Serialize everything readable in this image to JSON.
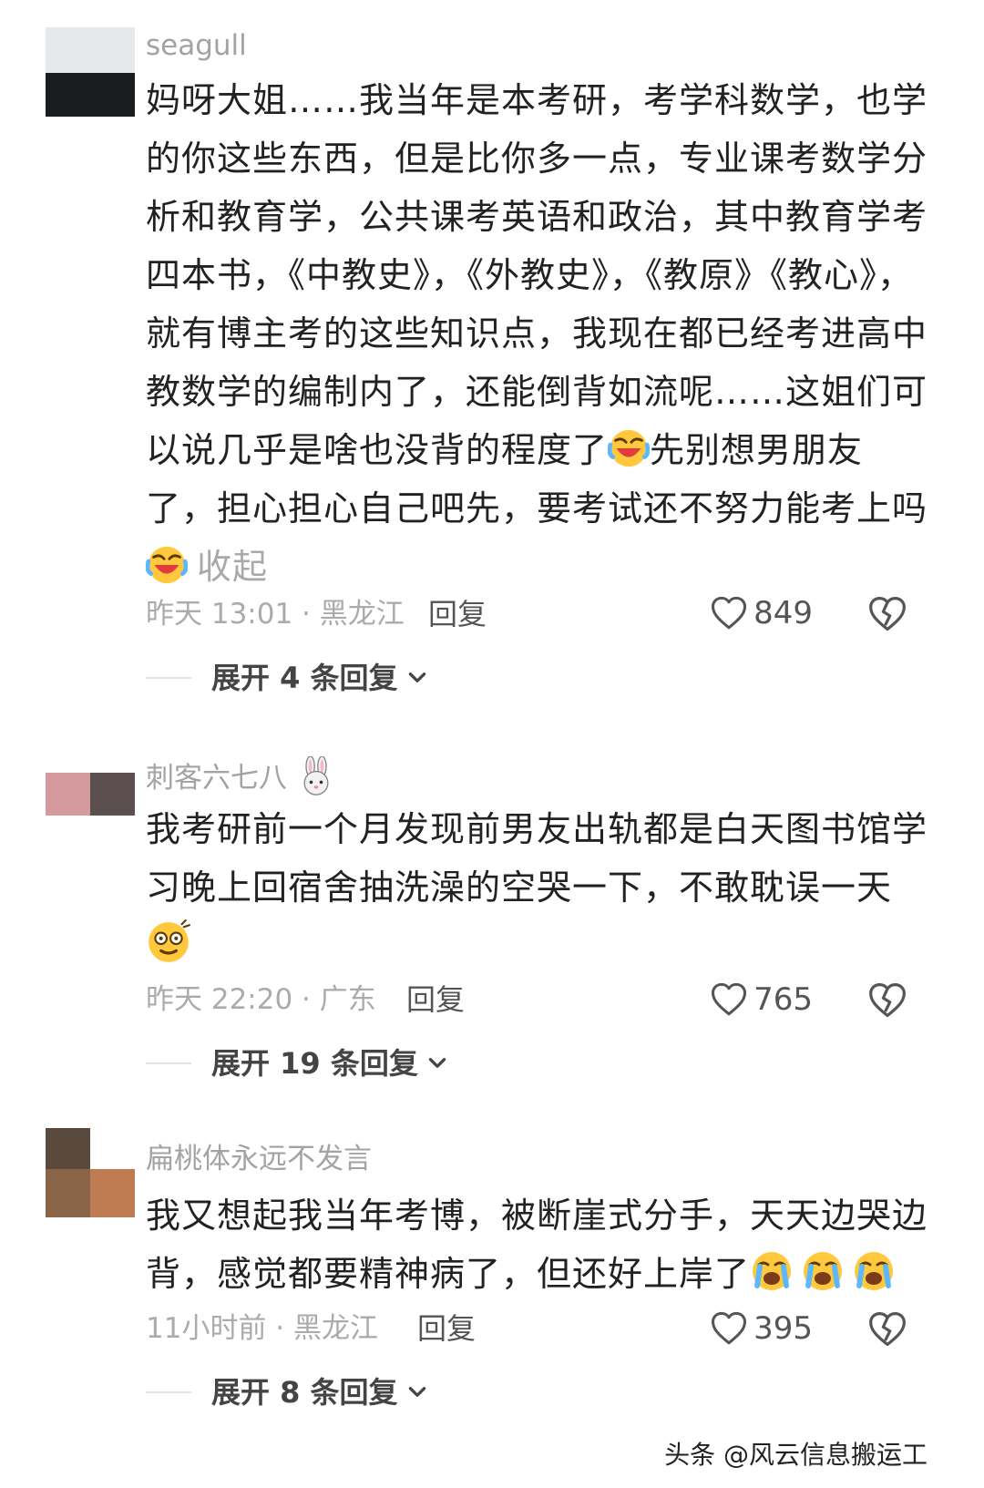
{
  "comments": [
    {
      "username": "seagull",
      "text_main": "妈呀大姐……我当年是本考研，考学科数学，也学的你这些东西，但是比你多一点，专业课考数学分析和教育学，公共课考英语和政治，其中教育学考四本书，《中教史》，《外教史》，《教原》《教心》，就有博主考的这些知识点，我现在都已经考进高中教数学的编制内了，还能倒背如流呢……这姐们可以说几乎是啥也没背的程度了",
      "text_after_emoji": "先别想男朋友了，担心担心自己吧先，要考试还不努力能考上吗",
      "collapse_label": "收起",
      "time_location": "昨天 13:01 · 黑龙江",
      "reply_label": "回复",
      "likes": "849",
      "expand_label": "展开 4 条回复"
    },
    {
      "username": "刺客六七八",
      "text_main": "我考研前一个月发现前男友出轨都是白天图书馆学习晚上回宿舍抽洗澡的空哭一下，不敢耽误一天",
      "time_location": "昨天 22:20 · 广东",
      "reply_label": "回复",
      "likes": "765",
      "expand_label": "展开 19 条回复"
    },
    {
      "username": "扁桃体永远不发言",
      "text_main": "我又想起我当年考博，被断崖式分手，天天边哭边背，感觉都要精神病了，但还好上岸了",
      "time_location": "11小时前 · 黑龙江",
      "reply_label": "回复",
      "likes": "395",
      "expand_label": "展开 8 条回复"
    }
  ],
  "watermark": "头条 @风云信息搬运工",
  "icons": {
    "like": "heart-outline-icon",
    "dislike": "broken-heart-icon",
    "expand": "chevron-down-icon",
    "emoji_laugh_cry": "laugh-cry-emoji",
    "emoji_dizzy": "dizzy-face-emoji",
    "emoji_crying": "crying-emoji",
    "username_badge": "rabbit-icon"
  },
  "colors": {
    "text": "#222222",
    "muted": "#a9a9a9",
    "action": "#555555"
  }
}
